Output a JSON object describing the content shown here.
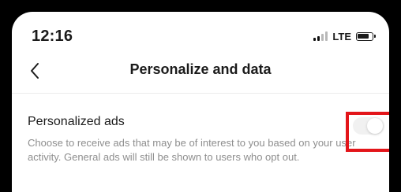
{
  "status_bar": {
    "time": "12:16",
    "network": "LTE",
    "signal_icon": "signal-icon",
    "battery_icon": "battery-icon"
  },
  "header": {
    "back_icon": "chevron-left-icon",
    "title": "Personalize and data"
  },
  "setting": {
    "label": "Personalized ads",
    "description": "Choose to receive ads that may be of interest to you based on your user activity. General ads will still be shown to users who opt out.",
    "toggle_state": "off"
  },
  "colors": {
    "highlight": "#e3151a",
    "text_primary": "#1b1b1b",
    "text_secondary": "#8e8e8e"
  }
}
